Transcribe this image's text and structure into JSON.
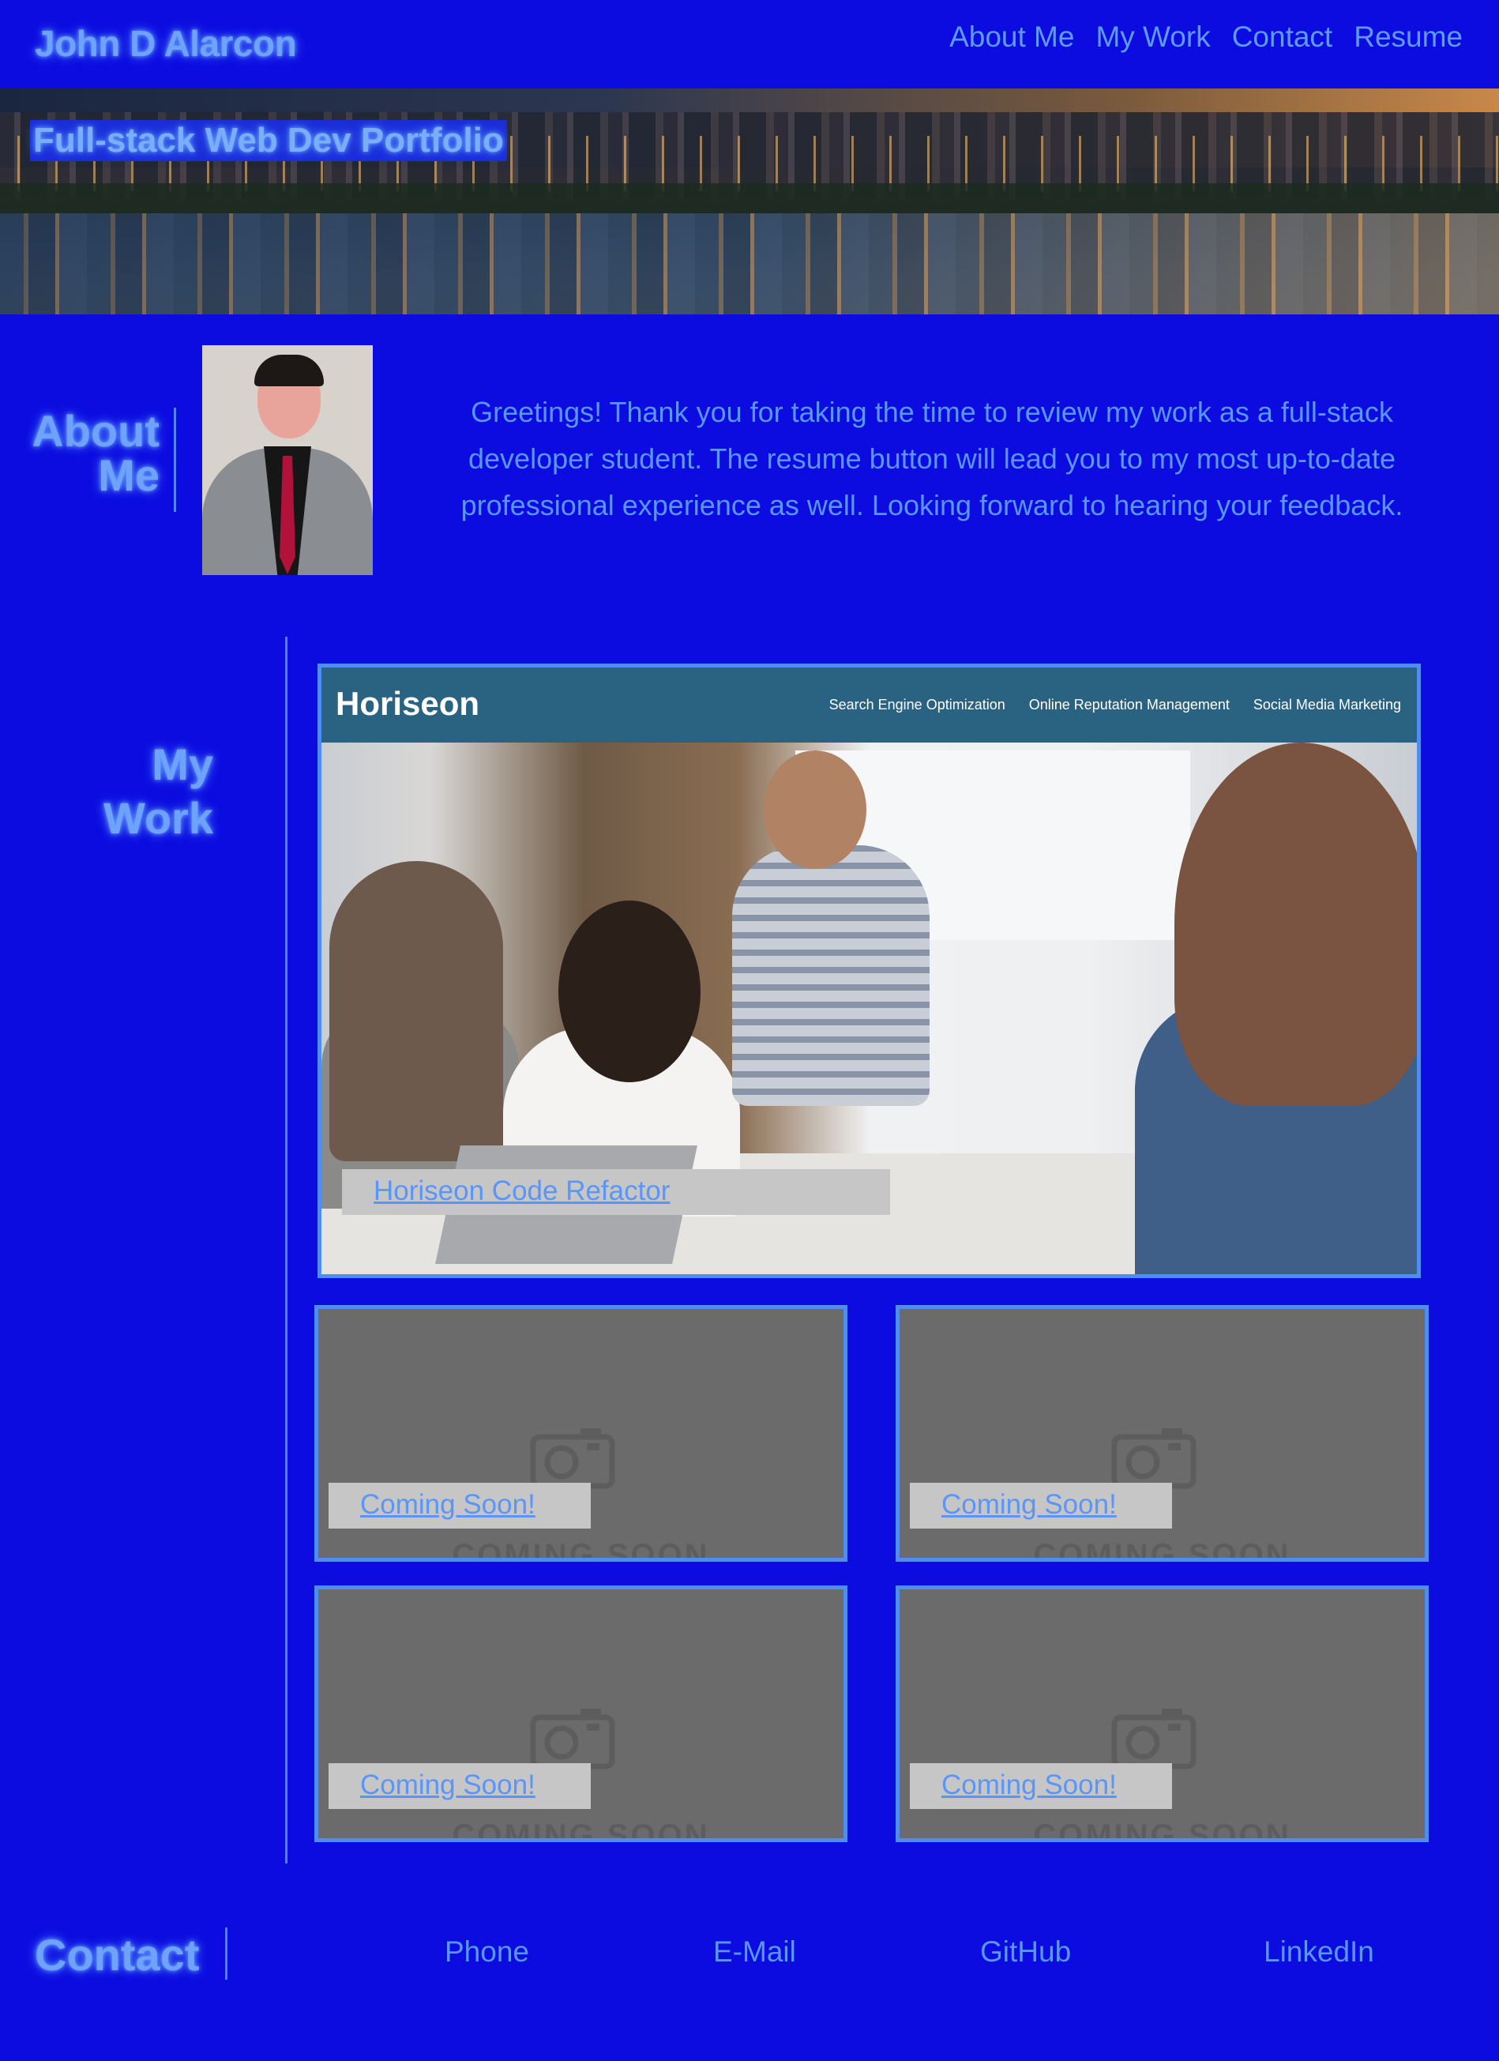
{
  "header": {
    "site_name": "John D Alarcon",
    "nav": [
      "About Me",
      "My Work",
      "Contact",
      "Resume"
    ]
  },
  "hero": {
    "title": "Full-stack Web Dev Portfolio"
  },
  "about": {
    "heading_line1": "About",
    "heading_line2": "Me",
    "text": "Greetings! Thank you for taking the time to review my work as a full-stack developer student. The resume button will lead you to my most up-to-date professional experience as well. Looking forward to hearing your feedback."
  },
  "work": {
    "heading_line1": "My",
    "heading_line2": "Work",
    "featured": {
      "brand": "Horiseon",
      "nav": [
        "Search Engine Optimization",
        "Online Reputation Management",
        "Social Media Marketing"
      ],
      "caption": "Horiseon Code Refactor"
    },
    "placeholders": [
      {
        "caption": "Coming Soon!",
        "image_text": "COMING SOON"
      },
      {
        "caption": "Coming Soon!",
        "image_text": "COMING SOON"
      },
      {
        "caption": "Coming Soon!",
        "image_text": "COMING SOON"
      },
      {
        "caption": "Coming Soon!",
        "image_text": "COMING SOON"
      }
    ]
  },
  "contact": {
    "heading": "Contact",
    "links": [
      "Phone",
      "E-Mail",
      "GitHub",
      "LinkedIn"
    ]
  },
  "colors": {
    "background": "#0c0ce0",
    "accent": "#5a95f8",
    "feature_bar": "#2a6282",
    "placeholder": "#6b6b6b",
    "caption_bg": "#c6c6c6"
  },
  "icons": [
    "camera-icon"
  ]
}
